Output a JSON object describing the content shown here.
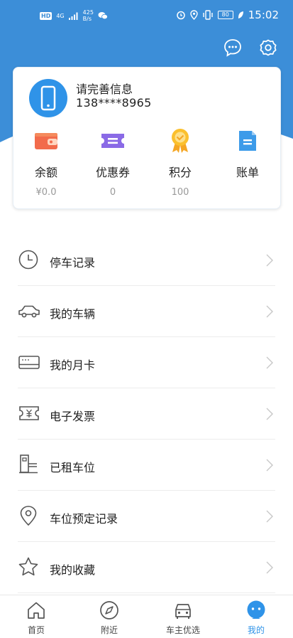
{
  "colors": {
    "accent": "#2f93e8",
    "header_bg": "#3c8ed8"
  },
  "status_bar": {
    "network": "4G",
    "speed_value": "425",
    "speed_unit": "B/s",
    "battery": "80",
    "time": "15:02"
  },
  "header": {
    "message_icon": "message-icon",
    "settings_icon": "gear-icon"
  },
  "profile": {
    "name": "请完善信息",
    "phone": "138****8965",
    "stats": [
      {
        "label": "余额",
        "value": "¥0.0",
        "icon": "wallet-icon"
      },
      {
        "label": "优惠券",
        "value": "0",
        "icon": "coupon-icon"
      },
      {
        "label": "积分",
        "value": "100",
        "icon": "medal-icon"
      },
      {
        "label": "账单",
        "value": "",
        "icon": "bill-icon"
      }
    ]
  },
  "menu": [
    {
      "label": "停车记录",
      "icon": "clock-icon"
    },
    {
      "label": "我的车辆",
      "icon": "car-icon"
    },
    {
      "label": "我的月卡",
      "icon": "card-icon"
    },
    {
      "label": "电子发票",
      "icon": "invoice-icon"
    },
    {
      "label": "已租车位",
      "icon": "parking-gate-icon"
    },
    {
      "label": "车位预定记录",
      "icon": "location-pin-icon"
    },
    {
      "label": "我的收藏",
      "icon": "star-icon"
    }
  ],
  "tabs": [
    {
      "label": "首页",
      "icon": "home-icon",
      "active": false
    },
    {
      "label": "附近",
      "icon": "compass-icon",
      "active": false
    },
    {
      "label": "车主优选",
      "icon": "car-front-icon",
      "active": false
    },
    {
      "label": "我的",
      "icon": "mine-face-icon",
      "active": true
    }
  ]
}
